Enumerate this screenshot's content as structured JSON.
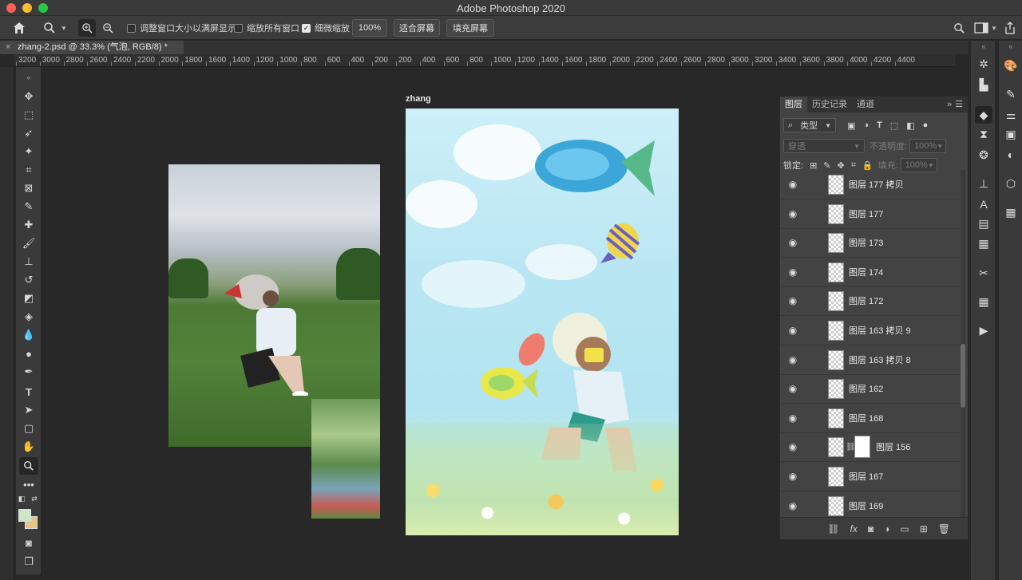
{
  "app": {
    "title": "Adobe Photoshop 2020"
  },
  "options_bar": {
    "resize_windows_label": "调整窗口大小以满屏显示",
    "zoom_all_windows_label": "缩放所有窗口",
    "scrubby_zoom_label": "细微缩放",
    "zoom_value": "100%",
    "fit_screen_label": "适合屏幕",
    "fill_screen_label": "填充屏幕"
  },
  "document": {
    "tab_title": "zhang-2.psd @ 33.3% (气泡, RGB/8) *",
    "artboard_label": "zhang"
  },
  "ruler": {
    "labels": [
      "3200",
      "3000",
      "2800",
      "2600",
      "2400",
      "2200",
      "2000",
      "1800",
      "1600",
      "1400",
      "1200",
      "1000",
      "800",
      "600",
      "400",
      "200",
      "200",
      "400",
      "600",
      "800",
      "1000",
      "1200",
      "1400",
      "1600",
      "1800",
      "2000",
      "2200",
      "2400",
      "2600",
      "2800",
      "3000",
      "3200",
      "3400",
      "3600",
      "3800",
      "4000",
      "4200",
      "4400"
    ]
  },
  "layers_panel": {
    "tabs": [
      "图层",
      "历史记录",
      "通道"
    ],
    "filter_label": "类型",
    "blend_mode": "穿透",
    "opacity_label": "不透明度:",
    "opacity_value": "100%",
    "lock_label": "锁定:",
    "fill_label": "填充:",
    "fill_value": "100%",
    "layers": [
      {
        "name": "图层 177 拷贝"
      },
      {
        "name": "图层 177"
      },
      {
        "name": "图层 173"
      },
      {
        "name": "图层 174"
      },
      {
        "name": "图层 172"
      },
      {
        "name": "图层 163 拷贝 9"
      },
      {
        "name": "图层 163 拷贝 8"
      },
      {
        "name": "图层 162"
      },
      {
        "name": "图层 168"
      },
      {
        "name": "图层 156"
      },
      {
        "name": "图层 167"
      },
      {
        "name": "图层 169"
      }
    ]
  },
  "colors": {
    "foreground": "#cfe6c6",
    "background": "#e5c48a"
  }
}
